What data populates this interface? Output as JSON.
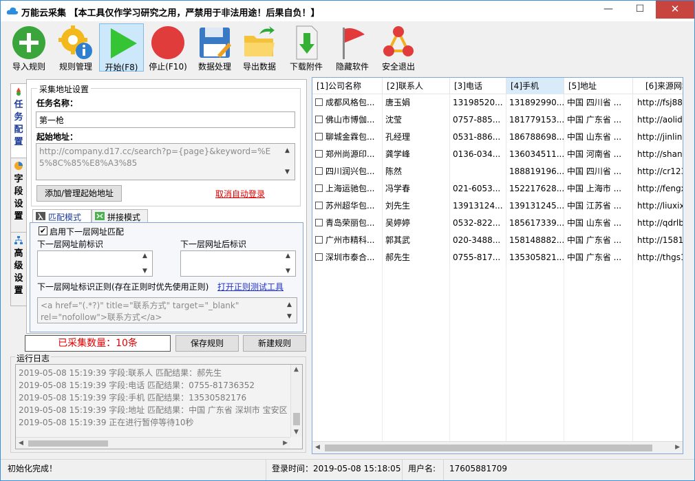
{
  "window": {
    "title": "万能云采集 【本工具仅作学习研究之用，严禁用于非法用途！后果自负！】",
    "min_symbol": "—",
    "max_symbol": "☐",
    "close_symbol": "✕"
  },
  "toolbar": [
    {
      "label": "导入规则",
      "icon": "plus-circle-icon"
    },
    {
      "label": "规则管理",
      "icon": "gear-info-icon"
    },
    {
      "label": "开始(F8)",
      "icon": "play-icon",
      "active": true
    },
    {
      "label": "停止(F10)",
      "icon": "stop-icon"
    },
    {
      "label": "数据处理",
      "icon": "floppy-icon"
    },
    {
      "label": "导出数据",
      "icon": "folder-export-icon"
    },
    {
      "label": "下载附件",
      "icon": "download-icon"
    },
    {
      "label": "隐藏软件",
      "icon": "flag-icon"
    },
    {
      "label": "安全退出",
      "icon": "exit-nodes-icon"
    }
  ],
  "vtabs": [
    {
      "label": "任务配置",
      "icon": "task-config-icon",
      "selected": true
    },
    {
      "label": "字段设置",
      "icon": "pie-icon",
      "selected": false
    },
    {
      "label": "高级设置",
      "icon": "network-icon",
      "selected": false
    }
  ],
  "collect": {
    "group_title": "采集地址设置",
    "task_name_label": "任务名称：",
    "task_name_value": "第一枪",
    "start_url_label": "起始地址：",
    "start_url_value": "http://company.d17.cc/search?p={page}&keyword=%E5%8C%85%E8%A3%85",
    "add_button": "添加/管理起始地址",
    "cancel_login_link": "取消自动登录"
  },
  "match": {
    "tab_match": "匹配模式",
    "tab_concat": "拼接模式",
    "enable_checkbox_label": "启用下一层网址匹配",
    "enable_checked": true,
    "prefix_label": "下一层网址前标识",
    "suffix_label": "下一层网址后标识",
    "regex_label": "下一层网址标识正则(存在正则时优先使用正则)",
    "regex_tool_link": "打开正则测试工具",
    "regex_value": "<a href=\"(.*?)\" title=\"联系方式\" target=\"_blank\" rel=\"nofollow\">联系方式</a>"
  },
  "actions": {
    "counter": "已采集数量：10条",
    "save_rule": "保存规则",
    "new_rule": "新建规则"
  },
  "log": {
    "title": "运行日志",
    "lines": [
      "2019-05-08 15:19:39 字段:联系人 匹配结果：郝先生",
      "2019-05-08 15:19:39 字段:电话 匹配结果：0755-81736352",
      "2019-05-08 15:19:39 字段:手机 匹配结果：13530582176",
      "2019-05-08 15:19:39 字段:地址 匹配结果：中国 广东省 深圳市 宝安区 8",
      "2019-05-08 15:19:39 正在进行暂停等待10秒"
    ]
  },
  "table": {
    "columns": [
      "[1]公司名称",
      "[2]联系人",
      "[3]电话",
      "[4]手机",
      "[5]地址",
      "[6]来源网址"
    ],
    "rows": [
      [
        "成都风格包...",
        "唐玉娟",
        "13198520...",
        "131892990...",
        "中国 四川省 ...",
        "http://fsj888"
      ],
      [
        "佛山市博伽...",
        "沈莹",
        "0757-885...",
        "181779153...",
        "中国 广东省 ...",
        "http://aolid"
      ],
      [
        "聊城金霖包...",
        "孔经理",
        "0531-886...",
        "186788698...",
        "中国 山东省 ...",
        "http://jinlinb"
      ],
      [
        "郑州尚源印...",
        "龚学峰",
        "0136-034...",
        "136034511...",
        "中国 河南省 ...",
        "http://shang"
      ],
      [
        "四川润兴包...",
        "陈然",
        "",
        "188819196...",
        "中国 四川省 ...",
        "http://cr123"
      ],
      [
        "上海运驰包...",
        "冯学春",
        "021-6053...",
        "152217628...",
        "中国 上海市 ...",
        "http://fengx"
      ],
      [
        "苏州超华包...",
        "刘先生",
        "13913124...",
        "139131245...",
        "中国 江苏省 ...",
        "http://liuxix"
      ],
      [
        "青岛荣丽包...",
        "吴婷婷",
        "0532-822...",
        "185617339...",
        "中国 山东省 ...",
        "http://qdrlb"
      ],
      [
        "广州市精科...",
        "郭其武",
        "020-3488...",
        "158148882...",
        "中国 广东省 ...",
        "http://1581"
      ],
      [
        "深圳市泰合...",
        "郝先生",
        "0755-817...",
        "135305821...",
        "中国 广东省 ...",
        "http://thgs1"
      ]
    ]
  },
  "status": {
    "init": "初始化完成！",
    "login_time": "登录时间：2019-05-08 15:18:05",
    "user_label": "用户名:",
    "user_value": "17605881709"
  }
}
